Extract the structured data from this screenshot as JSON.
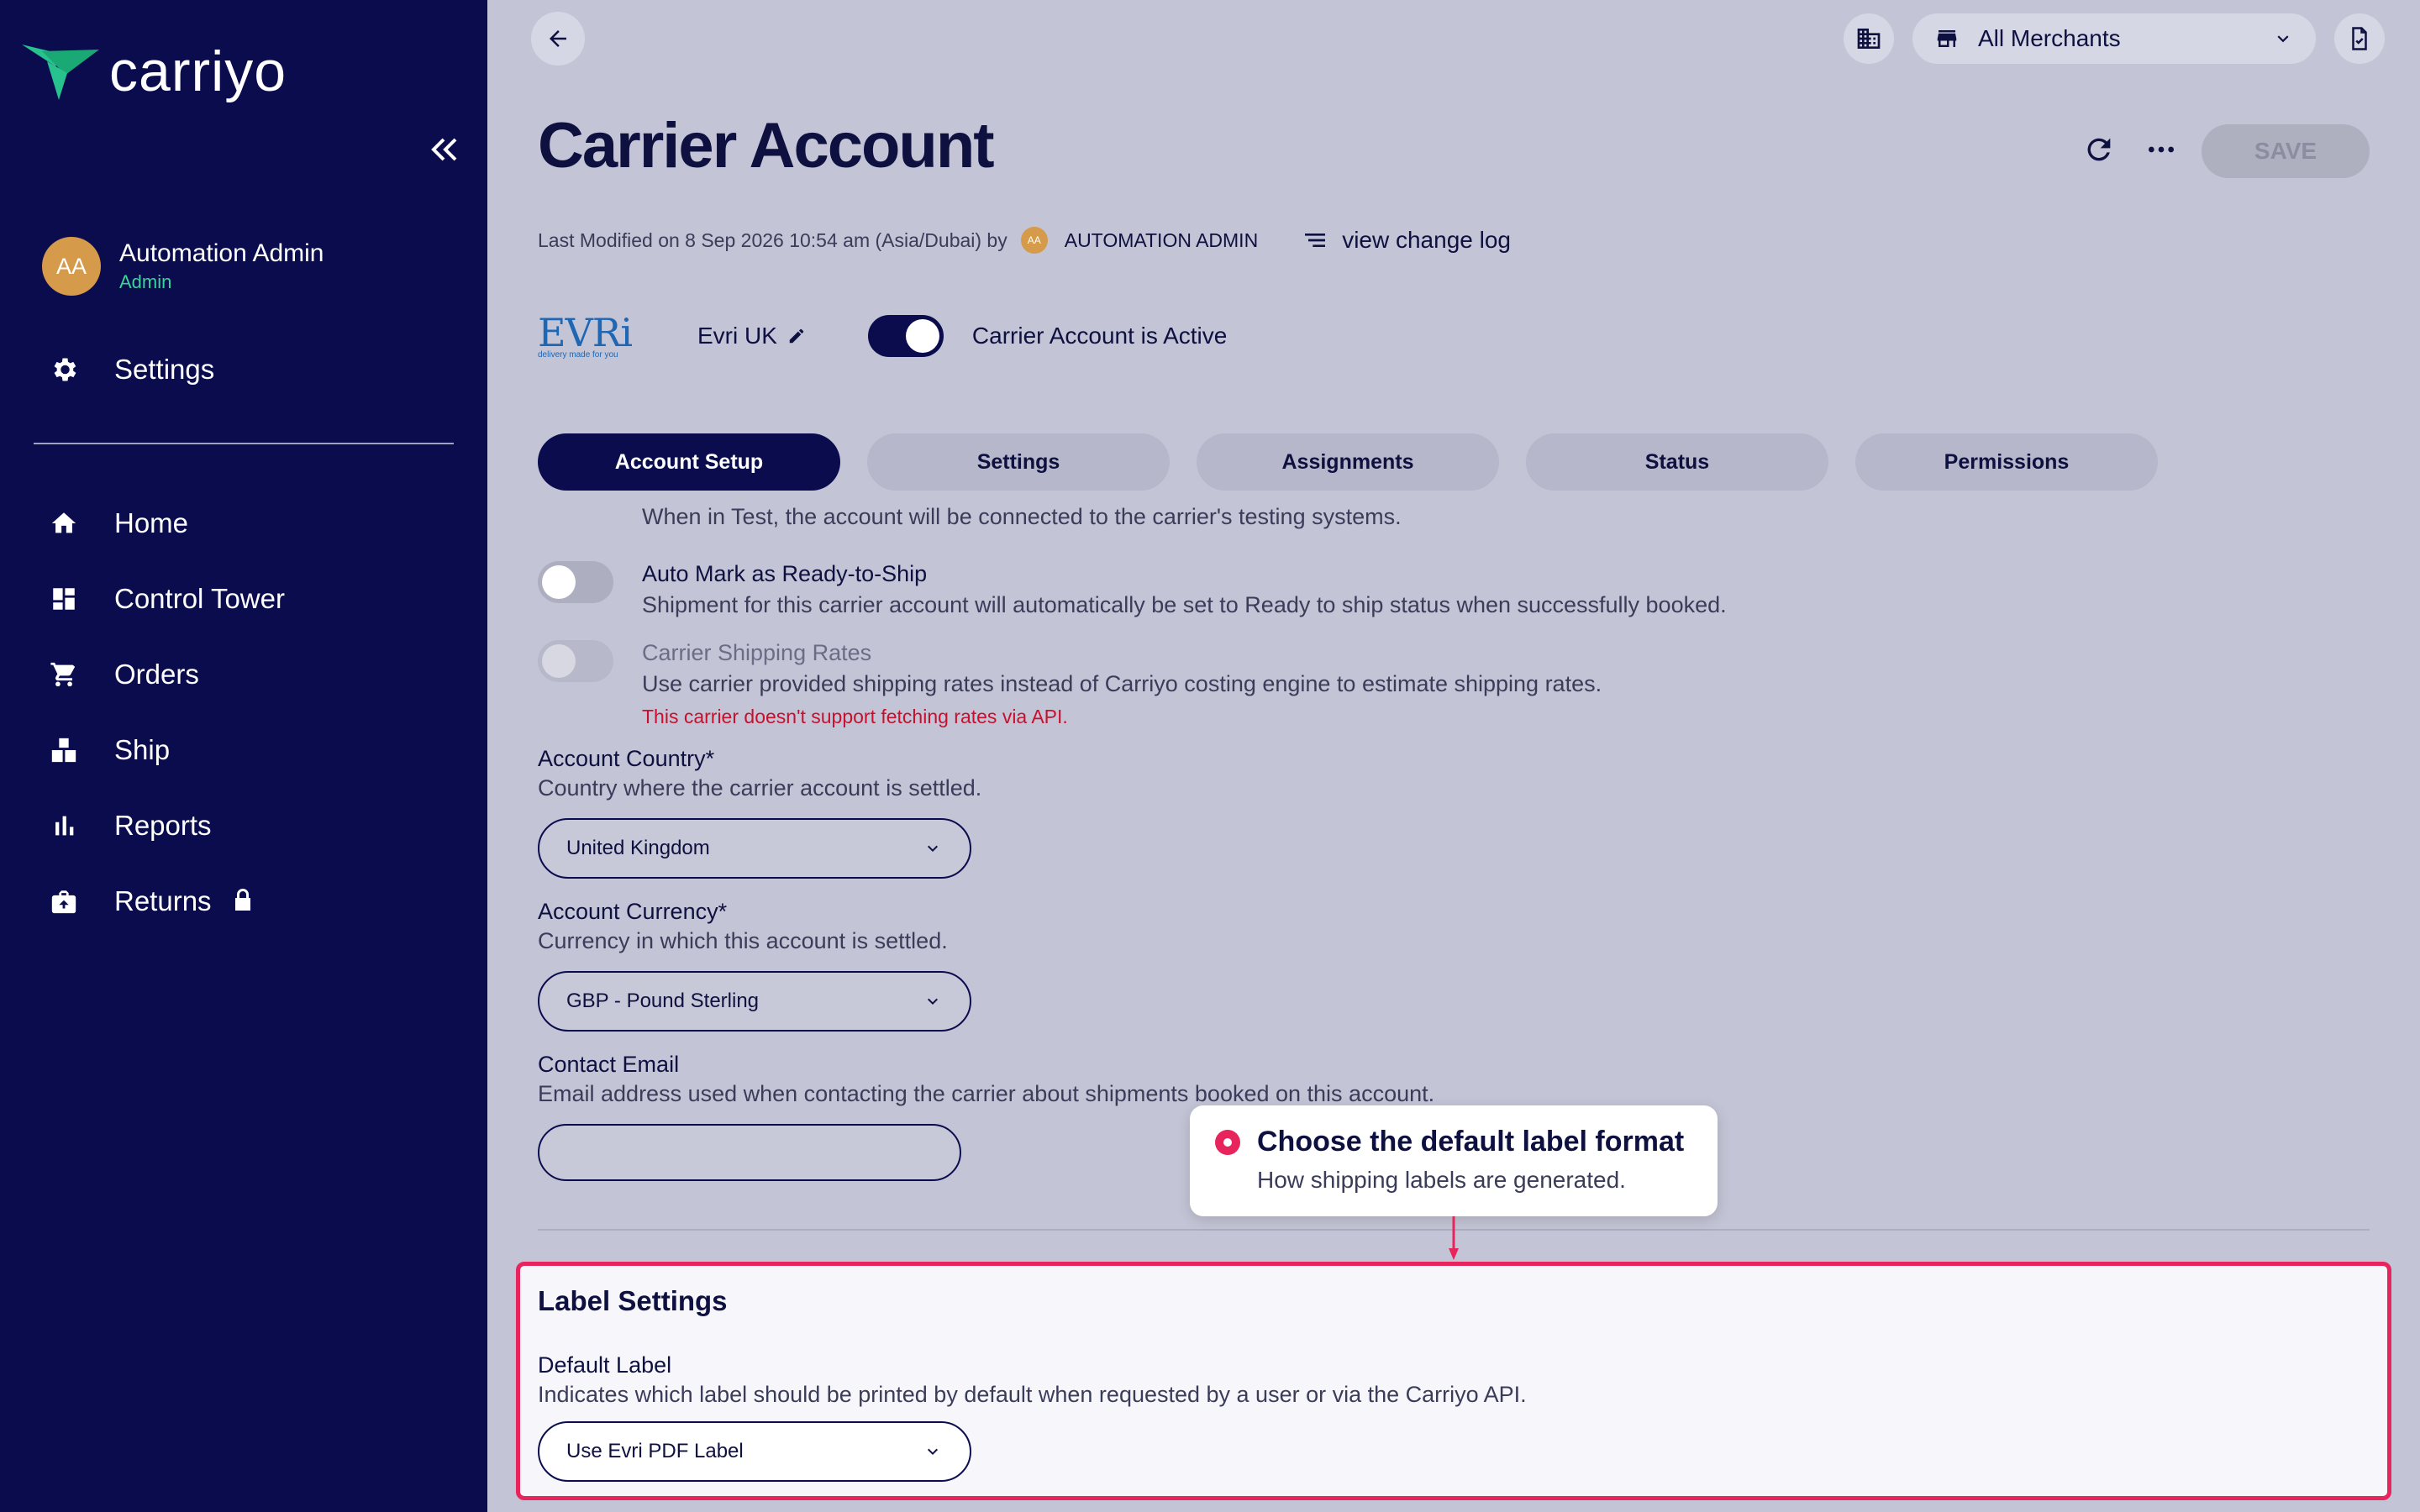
{
  "sidebar": {
    "logo_text": "carriyo",
    "user": {
      "initials": "AA",
      "name": "Automation Admin",
      "role": "Admin"
    },
    "settings_label": "Settings",
    "nav": [
      {
        "label": "Home",
        "icon": "home-icon"
      },
      {
        "label": "Control Tower",
        "icon": "dashboard-icon"
      },
      {
        "label": "Orders",
        "icon": "cart-icon"
      },
      {
        "label": "Ship",
        "icon": "ship-icon"
      },
      {
        "label": "Reports",
        "icon": "bar-chart-icon"
      },
      {
        "label": "Returns",
        "icon": "returns-icon"
      }
    ]
  },
  "header": {
    "merchant_select": "All Merchants",
    "title": "Carrier Account",
    "save_label": "SAVE",
    "modified_text": "Last Modified on 8 Sep 2026 10:54 am (Asia/Dubai) by",
    "modified_initials": "AA",
    "modified_user": "AUTOMATION ADMIN",
    "changelog_label": "view change log"
  },
  "carrier": {
    "logo_word": "EVRi",
    "logo_tagline": "delivery made for you",
    "name": "Evri UK",
    "active_label": "Carrier Account is Active"
  },
  "tabs": [
    "Account Setup",
    "Settings",
    "Assignments",
    "Status",
    "Permissions"
  ],
  "account_setup": {
    "cut_text": "When in Test, the account will be connected to the carrier's testing systems.",
    "auto_mark": {
      "title": "Auto Mark as Ready-to-Ship",
      "desc": "Shipment for this carrier account will automatically be set to Ready to ship status when successfully booked."
    },
    "shipping_rates": {
      "title": "Carrier Shipping Rates",
      "desc": "Use carrier provided shipping rates instead of Carriyo costing engine to estimate shipping rates.",
      "error": "This carrier doesn't support fetching rates via API."
    },
    "country": {
      "label": "Account Country*",
      "desc": "Country where the carrier account is settled.",
      "value": "United Kingdom"
    },
    "currency": {
      "label": "Account Currency*",
      "desc": "Currency in which this account is settled.",
      "value": "GBP - Pound Sterling"
    },
    "email": {
      "label": "Contact Email",
      "desc": "Email address used when contacting the carrier about shipments booked on this account.",
      "value": ""
    }
  },
  "label_settings": {
    "title": "Label Settings",
    "default_label": "Default Label",
    "desc": "Indicates which label should be printed by default when requested by a user or via the Carriyo API.",
    "value": "Use Evri PDF Label"
  },
  "tooltip": {
    "title": "Choose the default label format",
    "desc": "How shipping labels are generated."
  },
  "colors": {
    "sidebar_bg": "#0b0c4e",
    "accent_green": "#3ad49b",
    "highlight": "#e8245d",
    "error": "#c8102e"
  }
}
